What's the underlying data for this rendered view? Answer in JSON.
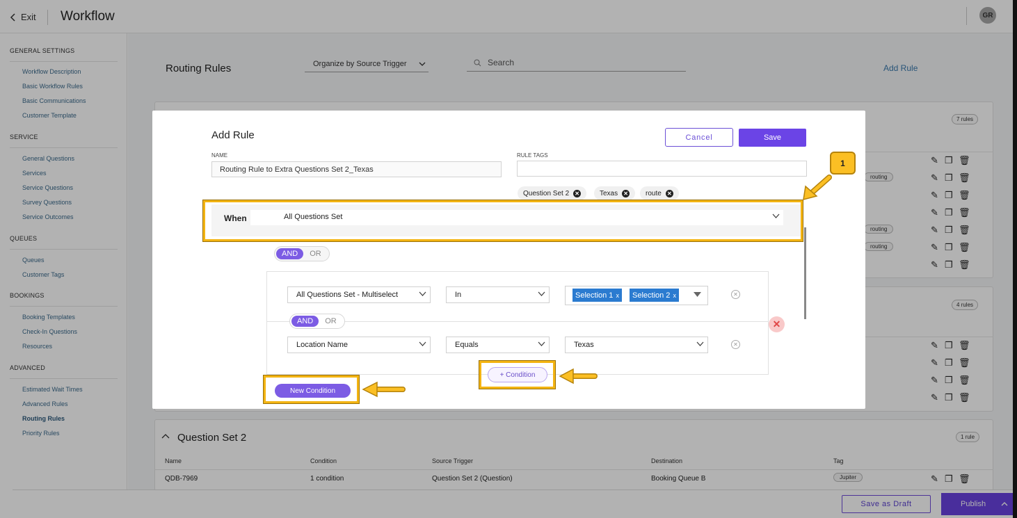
{
  "topbar": {
    "exit_label": "Exit",
    "title": "Workflow",
    "avatar_initials": "GR"
  },
  "sidebar": {
    "sections": [
      {
        "heading": "GENERAL SETTINGS",
        "items": [
          "Workflow Description",
          "Basic Workflow Rules",
          "Basic Communications",
          "Customer Template"
        ]
      },
      {
        "heading": "SERVICE",
        "items": [
          "General Questions",
          "Services",
          "Service Questions",
          "Survey Questions",
          "Service Outcomes"
        ]
      },
      {
        "heading": "QUEUES",
        "items": [
          "Queues",
          "Customer Tags"
        ]
      },
      {
        "heading": "BOOKINGS",
        "items": [
          "Booking Templates",
          "Check-In Questions",
          "Resources"
        ]
      },
      {
        "heading": "ADVANCED",
        "items": [
          "Estimated Wait Times",
          "Advanced Rules",
          "Routing Rules",
          "Priority Rules"
        ]
      }
    ],
    "active_item": "Routing Rules"
  },
  "main": {
    "title": "Routing Rules",
    "organize_by": "Organize by Source Trigger",
    "search_placeholder": "Search",
    "add_rule_label": "Add Rule",
    "card1_count": "7 rules",
    "card2_count": "4 rules",
    "bg_tags": [
      "routing",
      "routing",
      "routing"
    ],
    "question_set_2": {
      "title": "Question Set 2",
      "count": "1 rule",
      "columns": [
        "Name",
        "Condition",
        "Source Trigger",
        "Destination",
        "Tag"
      ],
      "row": {
        "name": "QDB-7969",
        "condition": "1 condition",
        "source_trigger": "Question Set 2 (Question)",
        "destination": "Booking Queue B",
        "tag": "Jupiter"
      }
    }
  },
  "footer": {
    "save_draft_label": "Save as Draft",
    "publish_label": "Publish"
  },
  "modal": {
    "title": "Add Rule",
    "cancel_label": "Cancel",
    "save_label": "Save",
    "name_label": "NAME",
    "name_value": "Routing Rule to Extra Questions Set 2_Texas",
    "rule_tags_label": "RULE TAGS",
    "tags": [
      "Question Set 2",
      "Texas",
      "route"
    ],
    "when_label": "When",
    "when_value": "All Questions Set",
    "logic_and": "AND",
    "logic_or": "OR",
    "conditions": [
      {
        "field": "All Questions Set - Multiselect",
        "operator": "In",
        "values": [
          "Selection 1",
          "Selection 2"
        ]
      },
      {
        "field": "Location Name",
        "operator": "Equals",
        "value": "Texas"
      }
    ],
    "add_condition_label": "+ Condition",
    "new_condition_label": "New Condition"
  },
  "annotation": {
    "badge_number": "1",
    "highlight_color": "#f3b413"
  },
  "colors": {
    "accent": "#6b44e6",
    "chip_blue": "#2b7bd0",
    "link": "#3a79ac"
  }
}
